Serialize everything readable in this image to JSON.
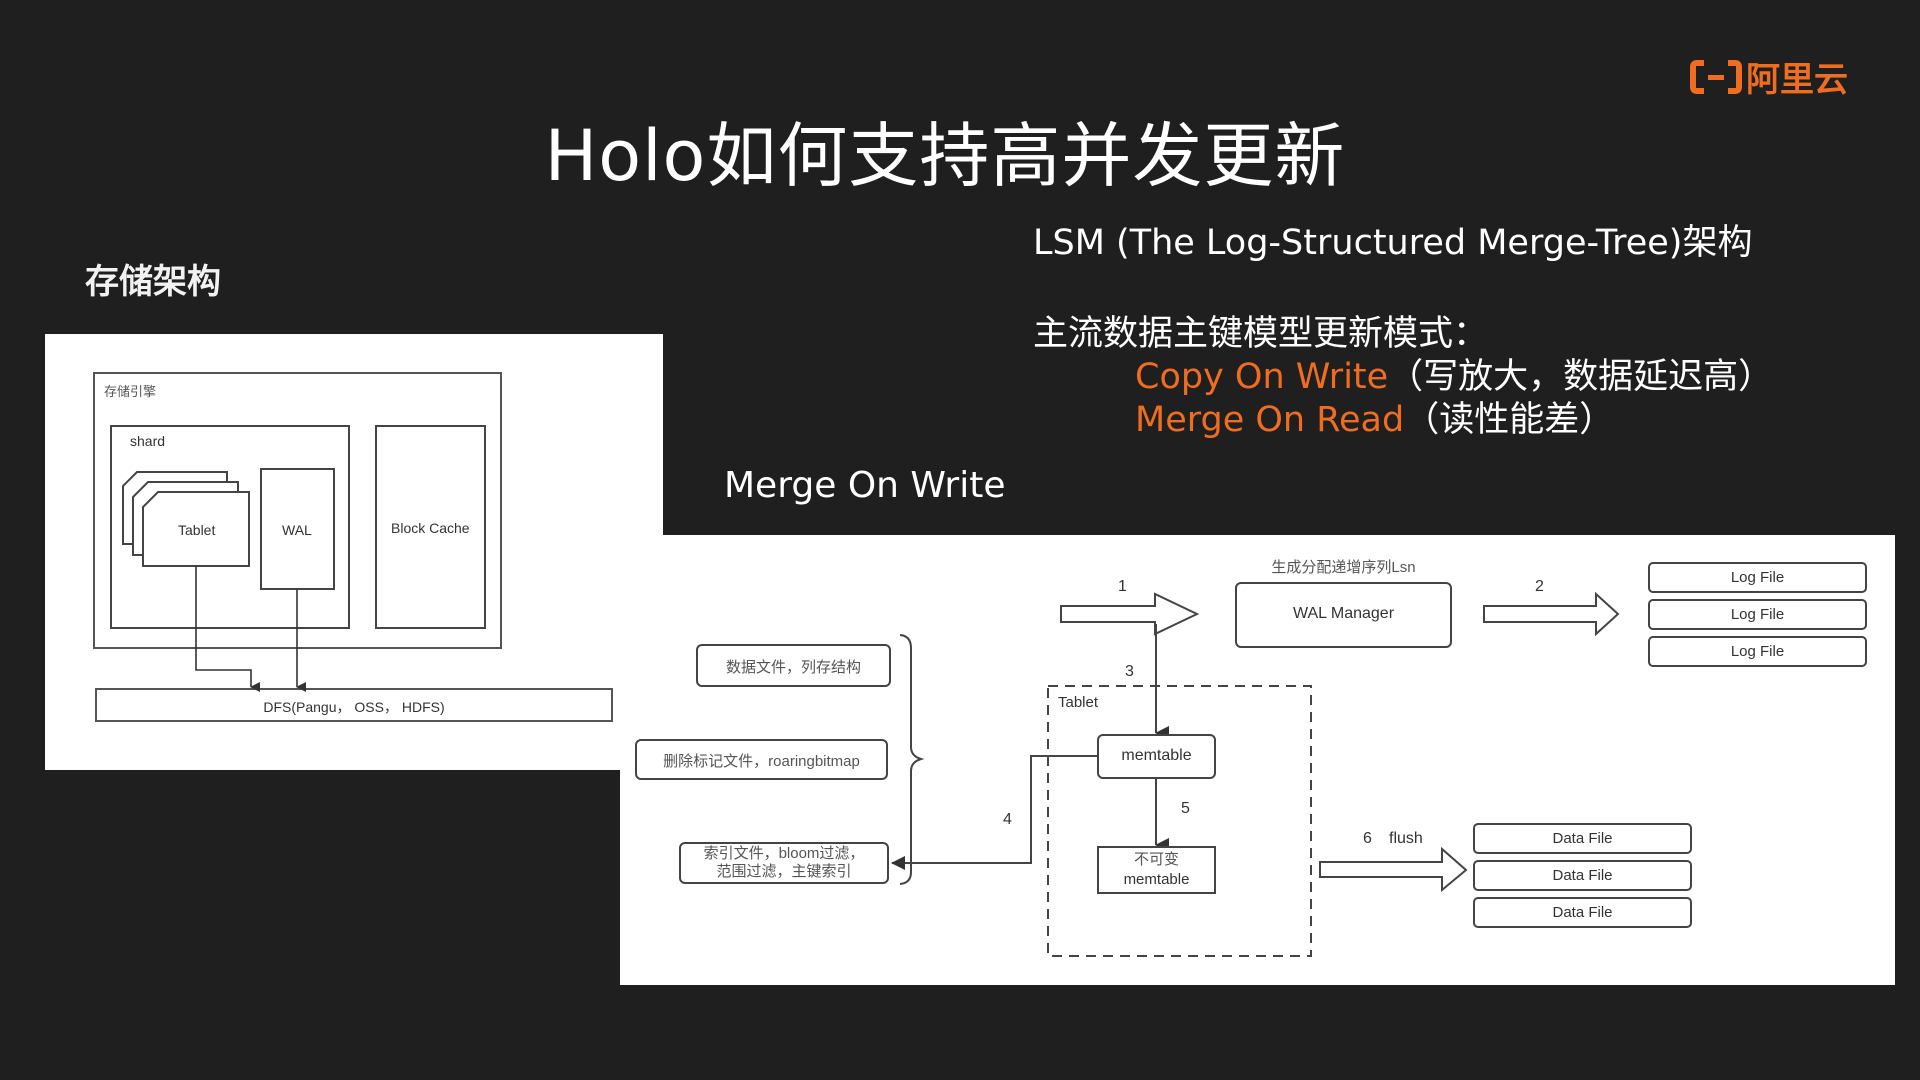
{
  "slide": {
    "title": "Holo如何支持高并发更新",
    "logo": {
      "icon": "alibaba-cloud-logo-icon",
      "text": "阿里云",
      "color": "#ee6d21"
    },
    "accent_color": "#ee6d21",
    "background_color": "#1f1f1f"
  },
  "storage_section": {
    "heading": "存储架构",
    "diagram": {
      "engine_label": "存储引擎",
      "shard_label": "shard",
      "tablet_label": "Tablet",
      "wal_label": "WAL",
      "block_cache_label": "Block Cache",
      "dfs_label": "DFS(Pangu， OSS， HDFS)"
    }
  },
  "lsm_section": {
    "heading": "LSM (The Log-Structured Merge-Tree)架构",
    "modes_heading": "主流数据主键模型更新模式：",
    "modes": [
      {
        "name": "Copy On Write",
        "note": "（写放大，数据延迟高）"
      },
      {
        "name": "Merge On Read",
        "note": "（读性能差）"
      }
    ]
  },
  "mow_section": {
    "heading": "Merge On Write",
    "diagram": {
      "wal_manager_label": "WAL Manager",
      "wal_manager_caption": "生成分配递增序列Lsn",
      "log_files": [
        "Log File",
        "Log File",
        "Log File"
      ],
      "data_files": [
        "Data File",
        "Data File",
        "Data File"
      ],
      "tablet_label": "Tablet",
      "memtable_label": "memtable",
      "immutable_memtable_label": [
        "不可变",
        "memtable"
      ],
      "file_types": [
        "数据文件，列存结构",
        "删除标记文件，roaringbitmap",
        "索引文件，bloom过滤，\n范围过滤，主键索引"
      ],
      "steps": {
        "s1": "1",
        "s2": "2",
        "s3": "3",
        "s4": "4",
        "s5": "5",
        "s6": "6",
        "s6_label": "flush"
      }
    }
  }
}
